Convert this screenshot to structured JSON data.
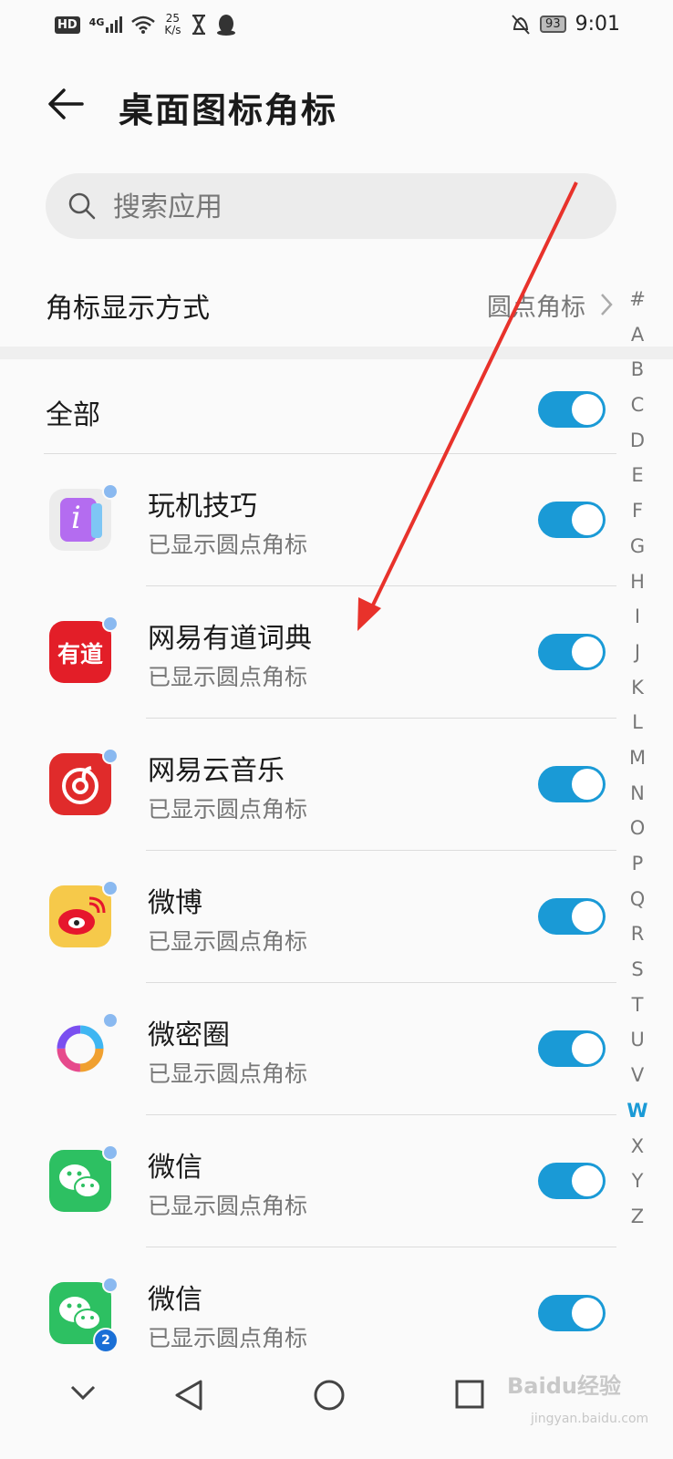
{
  "status_bar": {
    "hd": "HD",
    "net": "4G",
    "speed_value": "25",
    "speed_unit": "K/s",
    "battery": "93",
    "time": "9:01"
  },
  "header": {
    "title": "桌面图标角标",
    "back_icon": "back-arrow-icon"
  },
  "search": {
    "placeholder": "搜索应用",
    "icon": "search-icon"
  },
  "badge_display": {
    "label": "角标显示方式",
    "value": "圆点角标"
  },
  "all": {
    "label": "全部",
    "enabled": true
  },
  "apps": [
    {
      "name": "玩机技巧",
      "status": "已显示圆点角标",
      "enabled": true,
      "icon": "tips-app-icon"
    },
    {
      "name": "网易有道词典",
      "status": "已显示圆点角标",
      "enabled": true,
      "icon": "youdao-app-icon",
      "icon_text": "有道"
    },
    {
      "name": "网易云音乐",
      "status": "已显示圆点角标",
      "enabled": true,
      "icon": "netease-music-app-icon"
    },
    {
      "name": "微博",
      "status": "已显示圆点角标",
      "enabled": true,
      "icon": "weibo-app-icon"
    },
    {
      "name": "微密圈",
      "status": "已显示圆点角标",
      "enabled": true,
      "icon": "weimiquan-app-icon"
    },
    {
      "name": "微信",
      "status": "已显示圆点角标",
      "enabled": true,
      "icon": "wechat-app-icon"
    },
    {
      "name": "微信",
      "status": "已显示圆点角标",
      "enabled": true,
      "icon": "wechat-clone-app-icon",
      "clone_badge": "2"
    }
  ],
  "alpha_index": [
    "#",
    "A",
    "B",
    "C",
    "D",
    "E",
    "F",
    "G",
    "H",
    "I",
    "J",
    "K",
    "L",
    "M",
    "N",
    "O",
    "P",
    "Q",
    "R",
    "S",
    "T",
    "U",
    "V",
    "W",
    "X",
    "Y",
    "Z"
  ],
  "alpha_active": "W",
  "colors": {
    "accent": "#1a9ad6",
    "dot": "#8ab9f0",
    "annotation_arrow": "#e8322b"
  },
  "watermark": {
    "text": "Baidu经验",
    "sub": "jingyan.baidu.com"
  }
}
